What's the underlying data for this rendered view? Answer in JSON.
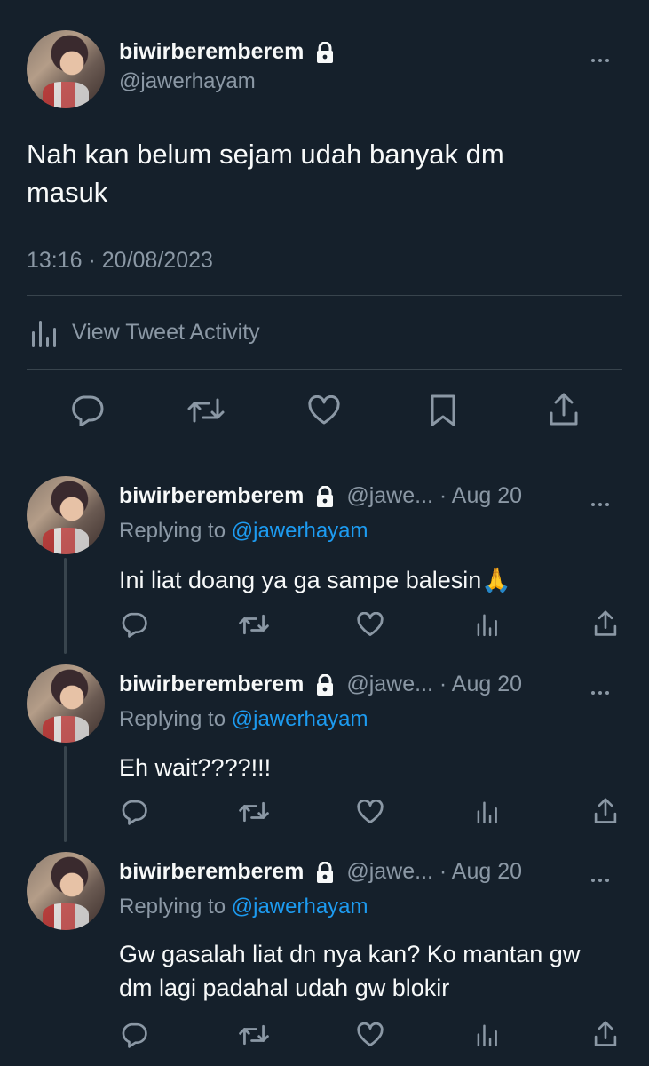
{
  "main_tweet": {
    "display_name": "biwirberemberem",
    "handle": "@jawerhayam",
    "text_line1": "Nah kan belum sejam udah banyak dm",
    "text_line2": "masuk",
    "timestamp": "13:16 · 20/08/2023",
    "activity_label": "View Tweet Activity"
  },
  "replies": [
    {
      "display_name": "biwirberemberem",
      "handle_date": "@jawe... · Aug 20",
      "replying_prefix": "Replying to",
      "replying_to": "@jawerhayam",
      "text_line1": "Ini liat doang ya ga sampe balesin🙏",
      "text_line2": ""
    },
    {
      "display_name": "biwirberemberem",
      "handle_date": "@jawe... · Aug 20",
      "replying_prefix": "Replying to",
      "replying_to": "@jawerhayam",
      "text_line1": "Eh wait????!!!",
      "text_line2": ""
    },
    {
      "display_name": "biwirberemberem",
      "handle_date": "@jawe... · Aug 20",
      "replying_prefix": "Replying to",
      "replying_to": "@jawerhayam",
      "text_line1": "Gw gasalah liat dn nya kan? Ko mantan gw",
      "text_line2": "dm lagi padahal udah gw blokir"
    }
  ],
  "icons": {
    "reply": "reply-icon",
    "retweet": "retweet-icon",
    "like": "heart-icon",
    "bookmark": "bookmark-icon",
    "share": "share-icon",
    "analytics": "analytics-icon",
    "more": "more-icon",
    "lock": "lock-icon"
  },
  "colors": {
    "background": "#15202b",
    "text": "#f7f9f9",
    "muted": "#8b98a5",
    "link": "#1d9bf0",
    "divider": "#38444d"
  }
}
